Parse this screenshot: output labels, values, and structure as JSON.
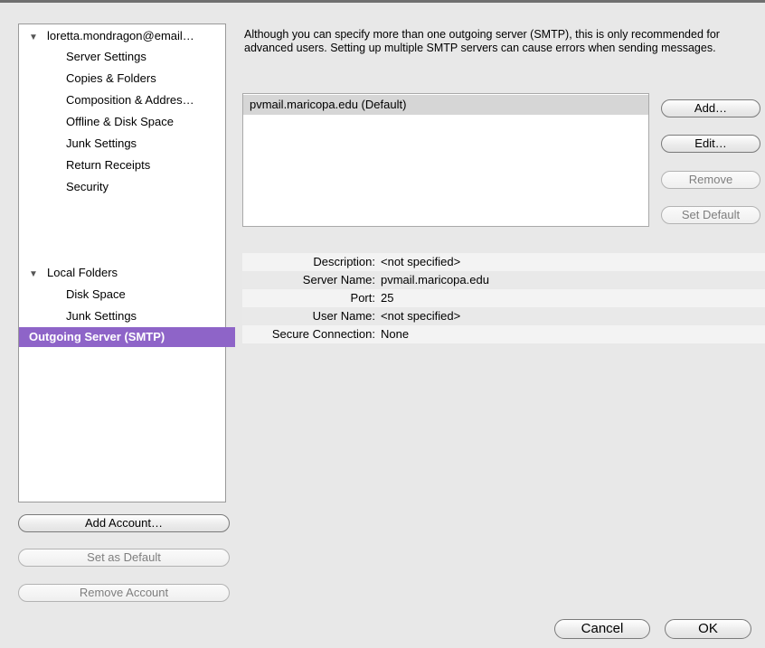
{
  "sidebar": {
    "account": "loretta.mondragon@email…",
    "account_items": [
      "Server Settings",
      "Copies & Folders",
      "Composition & Addres…",
      "Offline & Disk Space",
      "Junk Settings",
      "Return Receipts",
      "Security"
    ],
    "local_folders": "Local Folders",
    "local_items": [
      "Disk Space",
      "Junk Settings"
    ],
    "selected_item": "Outgoing Server (SMTP)",
    "expanded_glyph": "▼"
  },
  "sidebar_buttons": {
    "add_account": "Add Account…",
    "set_default": "Set as Default",
    "remove_account": "Remove Account"
  },
  "intro_text": "Although you can specify more than one outgoing server (SMTP), this is only recommended for advanced users. Setting up multiple SMTP servers can cause errors when sending messages.",
  "servers": [
    "pvmail.maricopa.edu (Default)"
  ],
  "server_buttons": {
    "add": "Add…",
    "edit": "Edit…",
    "remove": "Remove",
    "set_default": "Set Default"
  },
  "details": [
    {
      "label": "Description:",
      "value": "<not specified>"
    },
    {
      "label": "Server Name:",
      "value": "pvmail.maricopa.edu"
    },
    {
      "label": "Port:",
      "value": "25"
    },
    {
      "label": "User Name:",
      "value": "<not specified>"
    },
    {
      "label": "Secure Connection:",
      "value": "None"
    }
  ],
  "dialog_buttons": {
    "cancel": "Cancel",
    "ok": "OK"
  },
  "colors": {
    "selection": "#8e64c8",
    "selected_server": "#d6d6d6"
  }
}
